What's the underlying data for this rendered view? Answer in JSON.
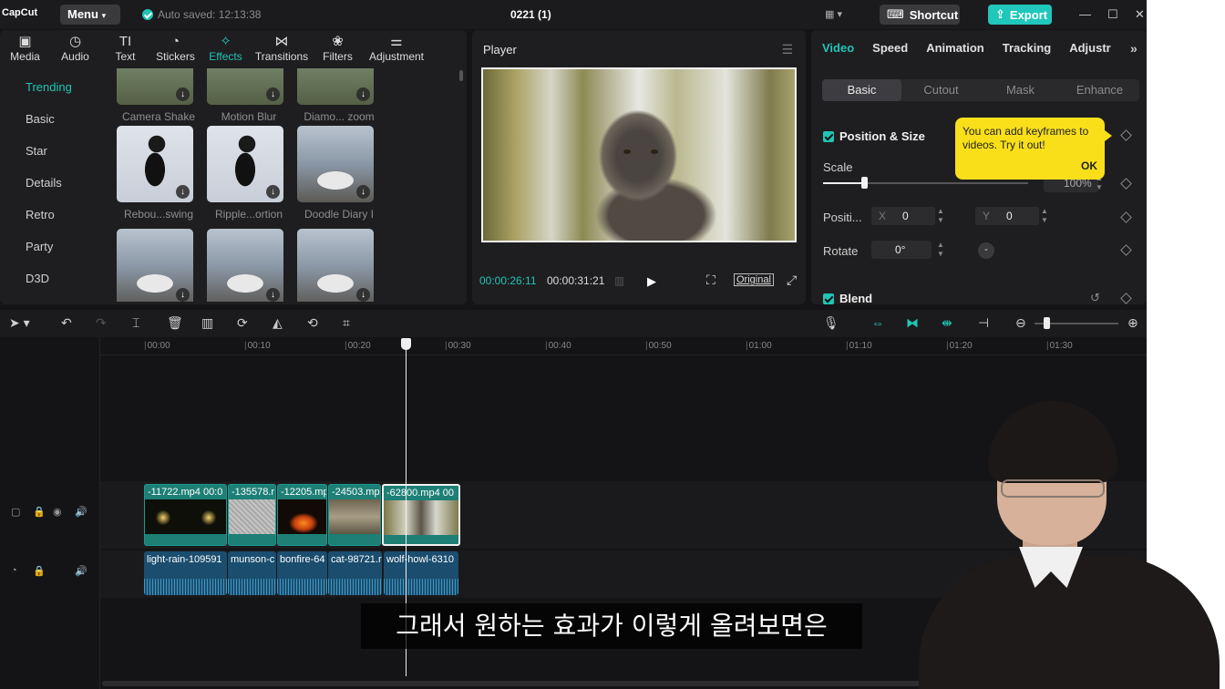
{
  "titlebar": {
    "logo": "CapCut",
    "menu_label": "Menu",
    "autosave": "Auto saved: 12:13:38",
    "project_title": "0221 (1)",
    "shortcut_label": "Shortcut",
    "export_label": "Export"
  },
  "media_tabs": [
    {
      "label": "Media",
      "icon": "media-icon",
      "glyph": "▣"
    },
    {
      "label": "Audio",
      "icon": "audio-icon",
      "glyph": "◷"
    },
    {
      "label": "Text",
      "icon": "text-icon",
      "glyph": "TI"
    },
    {
      "label": "Stickers",
      "icon": "stickers-icon",
      "glyph": "◔"
    },
    {
      "label": "Effects",
      "icon": "effects-icon",
      "glyph": "✧"
    },
    {
      "label": "Transitions",
      "icon": "transitions-icon",
      "glyph": "⋈"
    },
    {
      "label": "Filters",
      "icon": "filters-icon",
      "glyph": "❀"
    },
    {
      "label": "Adjustment",
      "icon": "adjustment-icon",
      "glyph": "⚌"
    }
  ],
  "effect_categories": [
    "Trending",
    "Basic",
    "Star",
    "Details",
    "Retro",
    "Party",
    "D3D"
  ],
  "effects": [
    {
      "label": "Camera Shake",
      "style": "field"
    },
    {
      "label": "Motion Blur",
      "style": "field"
    },
    {
      "label": "Diamo... zoom",
      "style": "field"
    },
    {
      "label": "Rebou...swing",
      "style": "woman"
    },
    {
      "label": "Ripple...ortion",
      "style": "woman"
    },
    {
      "label": "Doodle Diary I",
      "style": "car"
    },
    {
      "label": "",
      "style": "car"
    },
    {
      "label": "",
      "style": "car"
    },
    {
      "label": "",
      "style": "car"
    }
  ],
  "player": {
    "title": "Player",
    "current_time": "00:00:26:11",
    "duration": "00:00:31:21",
    "ratio_label": "Original"
  },
  "inspector": {
    "tabs": [
      "Video",
      "Speed",
      "Animation",
      "Tracking",
      "Adjustr"
    ],
    "subtabs": [
      "Basic",
      "Cutout",
      "Mask",
      "Enhance"
    ],
    "position_size": "Position & Size",
    "scale_label": "Scale",
    "scale_value": "100%",
    "scale_fraction": 0.2,
    "position_label": "Positi...",
    "x_label": "X",
    "x_value": "0",
    "y_label": "Y",
    "y_value": "0",
    "rotate_label": "Rotate",
    "rotate_value": "0°",
    "blend_label": "Blend",
    "tooltip_text": "You can add keyframes to videos. Try it out!",
    "tooltip_ok": "OK"
  },
  "timeline": {
    "ruler": [
      "00:00",
      "00:10",
      "00:20",
      "00:30",
      "00:40",
      "00:50",
      "01:00",
      "01:10",
      "01:20",
      "01:30"
    ],
    "video_clips": [
      {
        "name": "-11722.mp4  00:0"
      },
      {
        "name": "-135578.r"
      },
      {
        "name": "-12205.mp"
      },
      {
        "name": "-24503.mp"
      },
      {
        "name": "-62800.mp4  00"
      }
    ],
    "audio_clips": [
      {
        "name": "light-rain-109591"
      },
      {
        "name": "munson-c"
      },
      {
        "name": "bonfire-64"
      },
      {
        "name": "cat-98721.r"
      },
      {
        "name": "wolf-howl-6310"
      }
    ]
  },
  "subtitle": "그래서 원하는 효과가 이렇게 올려보면은",
  "colors": {
    "accent": "#21c4b5",
    "tooltip": "#f8df1a",
    "background": "#141416"
  }
}
